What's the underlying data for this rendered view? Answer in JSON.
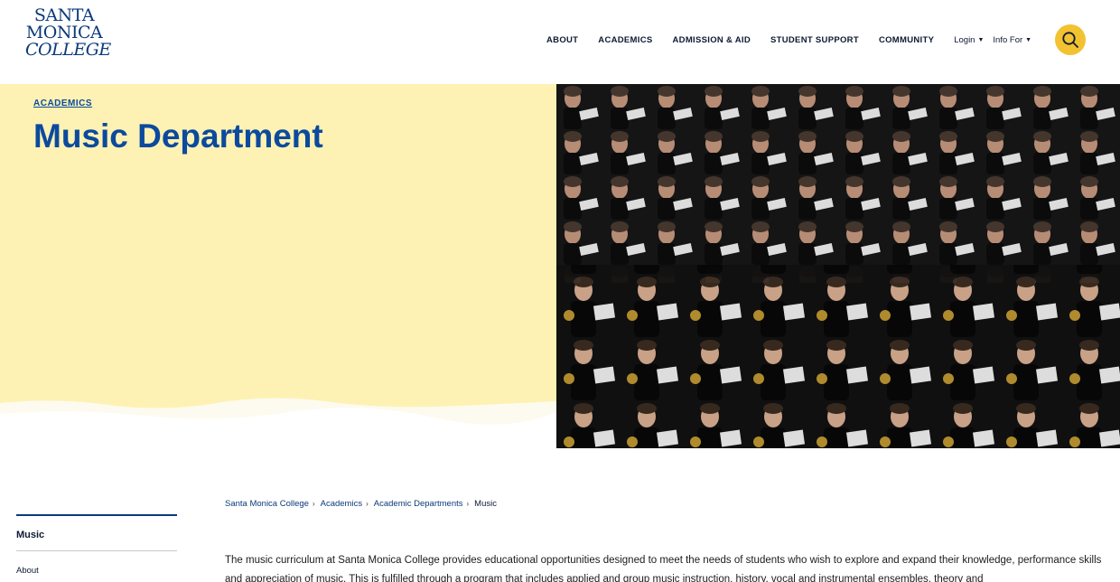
{
  "logo": {
    "line1": "SANTA",
    "line2": "MONICA",
    "line3": "COLLEGE"
  },
  "nav": {
    "items": [
      "ABOUT",
      "ACADEMICS",
      "ADMISSION & AID",
      "STUDENT SUPPORT",
      "COMMUNITY"
    ],
    "login": "Login",
    "info_for": "Info For"
  },
  "hero": {
    "eyebrow": "ACADEMICS",
    "title": "Music Department"
  },
  "sidebar": {
    "current": "Music",
    "links": [
      "About"
    ]
  },
  "breadcrumb": [
    "Santa Monica College",
    "Academics",
    "Academic Departments",
    "Music"
  ],
  "body": {
    "text": "The music curriculum at Santa Monica College provides educational opportunities designed to meet the needs of students who wish to explore and expand their knowledge, performance skills and appreciation of music. This is fulfilled through a program that includes applied and group music instruction, history, vocal and instrumental ensembles, theory and"
  },
  "colors": {
    "brand_blue": "#0b4a9e",
    "hero_yellow": "#fdf2b3",
    "search_yellow": "#f2c230"
  },
  "icons": {
    "search": "search-icon",
    "dropdown": "chevron-down-icon"
  }
}
